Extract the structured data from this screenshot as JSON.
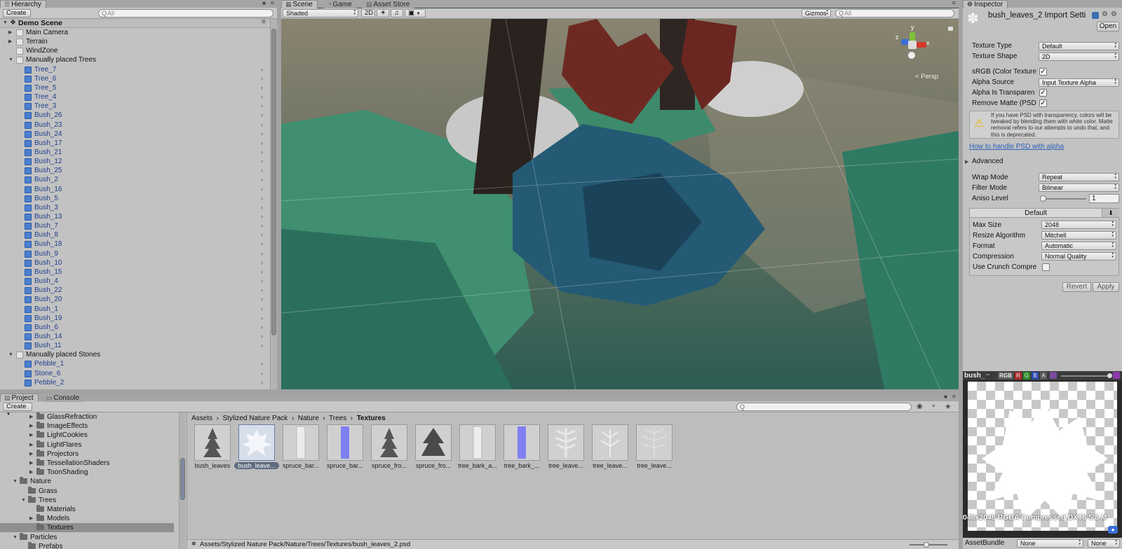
{
  "hierarchy": {
    "tab": "Hierarchy",
    "create": "Create",
    "search_placeholder": "All",
    "scene_name": "Demo Scene",
    "items": [
      {
        "label": "Main Camera",
        "indent": 1,
        "arrow": "right",
        "blue": false
      },
      {
        "label": "Terrain",
        "indent": 1,
        "arrow": "right",
        "blue": false
      },
      {
        "label": "WindZone",
        "indent": 1,
        "arrow": "",
        "blue": false
      },
      {
        "label": "Manually placed Trees",
        "indent": 1,
        "arrow": "down",
        "blue": false
      },
      {
        "label": "Tree_7",
        "indent": 2,
        "blue": true
      },
      {
        "label": "Tree_6",
        "indent": 2,
        "blue": true
      },
      {
        "label": "Tree_5",
        "indent": 2,
        "blue": true
      },
      {
        "label": "Tree_4",
        "indent": 2,
        "blue": true
      },
      {
        "label": "Tree_3",
        "indent": 2,
        "blue": true
      },
      {
        "label": "Bush_26",
        "indent": 2,
        "blue": true
      },
      {
        "label": "Bush_23",
        "indent": 2,
        "blue": true
      },
      {
        "label": "Bush_24",
        "indent": 2,
        "blue": true
      },
      {
        "label": "Bush_17",
        "indent": 2,
        "blue": true
      },
      {
        "label": "Bush_21",
        "indent": 2,
        "blue": true
      },
      {
        "label": "Bush_12",
        "indent": 2,
        "blue": true
      },
      {
        "label": "Bush_25",
        "indent": 2,
        "blue": true
      },
      {
        "label": "Bush_2",
        "indent": 2,
        "blue": true
      },
      {
        "label": "Bush_16",
        "indent": 2,
        "blue": true
      },
      {
        "label": "Bush_5",
        "indent": 2,
        "blue": true
      },
      {
        "label": "Bush_3",
        "indent": 2,
        "blue": true
      },
      {
        "label": "Bush_13",
        "indent": 2,
        "blue": true
      },
      {
        "label": "Bush_7",
        "indent": 2,
        "blue": true
      },
      {
        "label": "Bush_8",
        "indent": 2,
        "blue": true
      },
      {
        "label": "Bush_18",
        "indent": 2,
        "blue": true
      },
      {
        "label": "Bush_9",
        "indent": 2,
        "blue": true
      },
      {
        "label": "Bush_10",
        "indent": 2,
        "blue": true
      },
      {
        "label": "Bush_15",
        "indent": 2,
        "blue": true
      },
      {
        "label": "Bush_4",
        "indent": 2,
        "blue": true
      },
      {
        "label": "Bush_22",
        "indent": 2,
        "blue": true
      },
      {
        "label": "Bush_20",
        "indent": 2,
        "blue": true
      },
      {
        "label": "Bush_1",
        "indent": 2,
        "blue": true
      },
      {
        "label": "Bush_19",
        "indent": 2,
        "blue": true
      },
      {
        "label": "Bush_6",
        "indent": 2,
        "blue": true
      },
      {
        "label": "Bush_14",
        "indent": 2,
        "blue": true
      },
      {
        "label": "Bush_11",
        "indent": 2,
        "blue": true
      },
      {
        "label": "Manually placed Stones",
        "indent": 1,
        "arrow": "down",
        "blue": false
      },
      {
        "label": "Pebble_1",
        "indent": 2,
        "blue": true
      },
      {
        "label": "Stone_6",
        "indent": 2,
        "blue": true
      },
      {
        "label": "Pebble_2",
        "indent": 2,
        "blue": true
      }
    ]
  },
  "scene": {
    "tabs": [
      "Scene",
      "Game",
      "Asset Store"
    ],
    "shading_mode": "Shaded",
    "mode_2d": "2D",
    "gizmos": "Gizmos",
    "search_placeholder": "All",
    "gizmo_axes": {
      "y": "y",
      "x": "x",
      "z": "z"
    },
    "persp": "< Persp"
  },
  "inspector": {
    "tab": "Inspector",
    "title": "bush_leaves_2 Import Setti",
    "open": "Open",
    "fields": {
      "texture_type": {
        "label": "Texture Type",
        "value": "Default"
      },
      "texture_shape": {
        "label": "Texture Shape",
        "value": "2D"
      },
      "srgb": {
        "label": "sRGB (Color Texture",
        "checked": true
      },
      "alpha_source": {
        "label": "Alpha Source",
        "value": "Input Texture Alpha"
      },
      "alpha_transparency": {
        "label": "Alpha Is Transparen",
        "checked": true
      },
      "remove_matte": {
        "label": "Remove Matte (PSD",
        "checked": true
      }
    },
    "warning": "If you have PSD with transparency, colors will be tweaked by blending them with white color. Matte removal refers to our attempts to undo that, and this is deprecated.",
    "psd_link": "How to handle PSD with alpha",
    "advanced": "Advanced",
    "wrap_mode": {
      "label": "Wrap Mode",
      "value": "Repeat"
    },
    "filter_mode": {
      "label": "Filter Mode",
      "value": "Bilinear"
    },
    "aniso_level": {
      "label": "Aniso Level",
      "value": "1",
      "fraction": 0.06
    },
    "platform_tab": "Default",
    "max_size": {
      "label": "Max Size",
      "value": "2048"
    },
    "resize_algorithm": {
      "label": "Resize Algorithm",
      "value": "Mitchell"
    },
    "format": {
      "label": "Format",
      "value": "Automatic"
    },
    "compression": {
      "label": "Compression",
      "value": "Normal Quality"
    },
    "crunch": {
      "label": "Use Crunch Compre",
      "checked": false
    },
    "revert": "Revert",
    "apply": "Apply"
  },
  "preview": {
    "title": "bush_",
    "channels": [
      "RGB",
      "R",
      "G",
      "B",
      "A"
    ],
    "info": "048x2048  RGBA Compressed DXT5   5.3 M",
    "assetbundle_label": "AssetBundle",
    "assetbundle_value": "None",
    "variant_value": "None"
  },
  "project": {
    "tabs": [
      "Project",
      "Console"
    ],
    "create": "Create",
    "tree": [
      {
        "label": "GlassRefraction",
        "level": 3,
        "arrow": "right"
      },
      {
        "label": "ImageEffects",
        "level": 3,
        "arrow": "right"
      },
      {
        "label": "LightCookies",
        "level": 3,
        "arrow": "right"
      },
      {
        "label": "LightFlares",
        "level": 3,
        "arrow": "right"
      },
      {
        "label": "Projectors",
        "level": 3,
        "arrow": "right"
      },
      {
        "label": "TessellationShaders",
        "level": 3,
        "arrow": "right"
      },
      {
        "label": "ToonShading",
        "level": 3,
        "arrow": "right"
      },
      {
        "label": "Nature",
        "level": 1,
        "arrow": "down"
      },
      {
        "label": "Grass",
        "level": 2,
        "arrow": ""
      },
      {
        "label": "Trees",
        "level": 2,
        "arrow": "down"
      },
      {
        "label": "Materials",
        "level": 3,
        "arrow": ""
      },
      {
        "label": "Models",
        "level": 3,
        "arrow": "right"
      },
      {
        "label": "Textures",
        "level": 3,
        "arrow": "",
        "selected": true
      },
      {
        "label": "Particles",
        "level": 1,
        "arrow": "down"
      },
      {
        "label": "Prefabs",
        "level": 2,
        "arrow": ""
      }
    ],
    "breadcrumb": [
      "Assets",
      "Stylized Nature Pack",
      "Nature",
      "Trees",
      "Textures"
    ],
    "assets": [
      {
        "label": "bush_leaves",
        "kind": "tree-dark"
      },
      {
        "label": "bush_leave...",
        "kind": "leaf-white",
        "selected": true
      },
      {
        "label": "spruce_bar...",
        "kind": "bar-white"
      },
      {
        "label": "spruce_bar...",
        "kind": "bar-blue"
      },
      {
        "label": "spruce_fro...",
        "kind": "tree-dark"
      },
      {
        "label": "spruce_fro...",
        "kind": "tree-dark2"
      },
      {
        "label": "tree_bark_a...",
        "kind": "bar-white"
      },
      {
        "label": "tree_bark_...",
        "kind": "bar-blue"
      },
      {
        "label": "tree_leave...",
        "kind": "tree-light"
      },
      {
        "label": "tree_leave...",
        "kind": "tree-light2"
      },
      {
        "label": "tree_leave...",
        "kind": "tree-light3"
      }
    ],
    "status_path": "Assets/Stylized Nature Pack/Nature/Trees/Textures/bush_leaves_2.psd"
  }
}
